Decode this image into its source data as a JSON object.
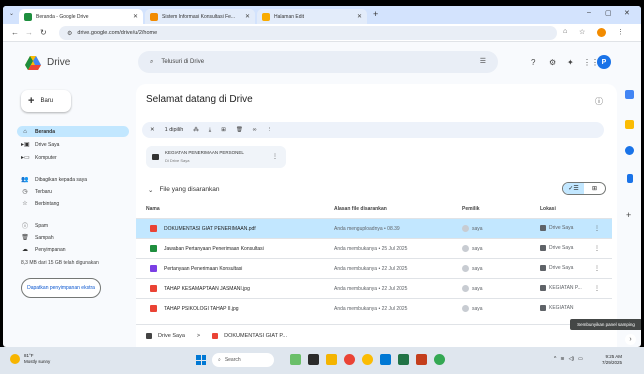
{
  "browser": {
    "tabs": [
      {
        "title": "Beranda - Google Drive",
        "color": "#1e8e3e"
      },
      {
        "title": "Sistem Informasi Konsultasi Fe...",
        "color": "#f28b00"
      },
      {
        "title": "Halaman Edit",
        "color": "#f9ab00"
      }
    ],
    "new_tab": "+",
    "url": "drive.google.com/drive/u/2/home",
    "window_controls": [
      "–",
      "▢",
      "✕"
    ]
  },
  "drive": {
    "brand": "Drive",
    "search_placeholder": "Telusuri di Drive",
    "avatar_letter": "P"
  },
  "sidebar": {
    "new_label": "Baru",
    "items": [
      {
        "label": "Beranda",
        "icon": "home-icon",
        "active": true
      },
      {
        "label": "Drive Saya",
        "icon": "drive-icon"
      },
      {
        "label": "Komputer",
        "icon": "computer-icon"
      },
      {
        "label": "Dibagikan kepada saya",
        "icon": "shared-icon"
      },
      {
        "label": "Terbaru",
        "icon": "clock-icon"
      },
      {
        "label": "Berbintang",
        "icon": "star-icon"
      },
      {
        "label": "Spam",
        "icon": "spam-icon"
      },
      {
        "label": "Sampah",
        "icon": "trash-icon"
      },
      {
        "label": "Penyimpanan",
        "icon": "cloud-icon"
      }
    ],
    "storage_text": "8,3 MB dari 15 GB telah digunakan",
    "storage_button": "Dapatkan penyimpanan ekstra"
  },
  "main": {
    "welcome": "Selamat datang di Drive",
    "selection": {
      "count_label": "1 dipilih"
    },
    "quick_card": {
      "title": "KEGIATAN PENERIMAAN PERSONEL",
      "subtitle": "Di Drive Saya"
    },
    "section_title": "File yang disarankan",
    "columns": [
      "Nama",
      "Alasan file disarankan",
      "Pemilik",
      "Lokasi"
    ],
    "rows": [
      {
        "name": "DOKUMENTASI GIAT PENERIMAAN.pdf",
        "reason": "Anda menguploadnya • 08.39",
        "owner": "saya",
        "location": "Drive Saya",
        "color": "#ea4335",
        "selected": true
      },
      {
        "name": "Jawaban Pertanyaan Penerimaan Konsultasi",
        "reason": "Anda membukanya • 25 Jul 2025",
        "owner": "saya",
        "location": "Drive Saya",
        "color": "#1e8e3e",
        "selected": false
      },
      {
        "name": "Pertanyaan Penerimaan Konsultasi",
        "reason": "Anda membukanya • 22 Jul 2025",
        "owner": "saya",
        "location": "Drive Saya",
        "color": "#7b3fe4",
        "selected": false
      },
      {
        "name": "TAHAP KESAMAPTAAN JASMANI.jpg",
        "reason": "Anda membukanya • 22 Jul 2025",
        "owner": "saya",
        "location": "KEGIATAN P...",
        "color": "#ea4335",
        "selected": false
      },
      {
        "name": "TAHAP PSIKOLOGI TAHAP II.jpg",
        "reason": "Anda membukanya • 22 Jul 2025",
        "owner": "saya",
        "location": "KEGIATAN",
        "color": "#ea4335",
        "selected": false
      }
    ],
    "breadcrumb": [
      "Drive Saya",
      ">",
      "DOKUMENTASI GIAT P..."
    ],
    "tooltip": "Sembunyikan panel samping"
  },
  "taskbar": {
    "weather_temp": "81°F",
    "weather_desc": "Mostly sunny",
    "search_label": "Search",
    "time": "9:25 AM",
    "date": "7/29/2025"
  }
}
